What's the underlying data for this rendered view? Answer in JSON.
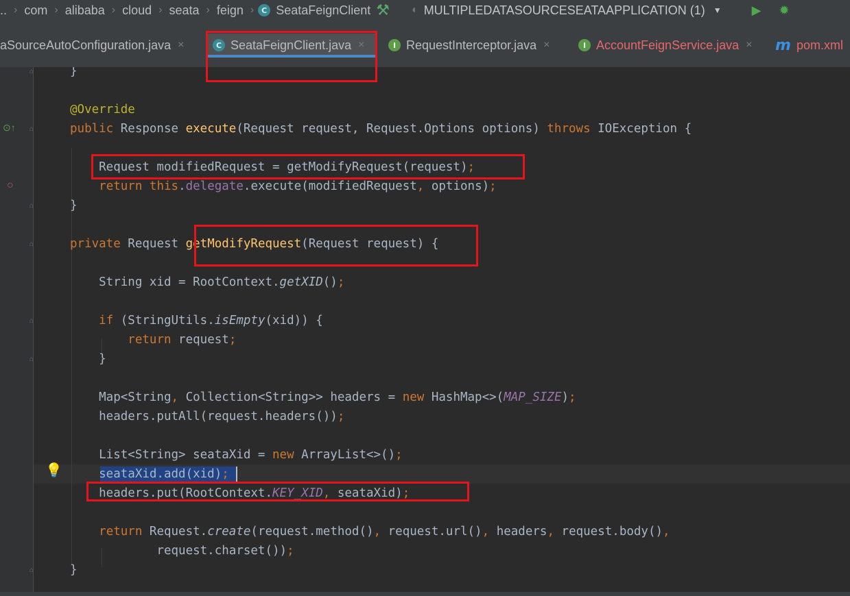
{
  "breadcrumb": {
    "items": [
      "..",
      "com",
      "alibaba",
      "cloud",
      "seata",
      "feign"
    ],
    "current_class": "SeataFeignClient",
    "run_config": "MULTIPLEDATASOURCESEATAAPPLICATION (1)"
  },
  "tabs": [
    {
      "label": "aSourceAutoConfiguration.java",
      "icon": "none",
      "active": false
    },
    {
      "label": "SeataFeignClient.java",
      "icon": "class-icon",
      "active": true
    },
    {
      "label": "RequestInterceptor.java",
      "icon": "interface-icon",
      "active": false
    },
    {
      "label": "AccountFeignService.java",
      "icon": "interface-icon",
      "active": false
    },
    {
      "label": "pom.xml",
      "icon": "maven-icon",
      "active": false
    }
  ],
  "tab_close_glyph": "×",
  "icon_glyphs": {
    "class": "C",
    "interface": "I",
    "maven": "m",
    "separator": "›",
    "hammer": "⚒",
    "dropdown": "▼",
    "run": "▶",
    "debug": "✹",
    "bulb": "💡"
  },
  "colors": {
    "keyword": "#cc7832",
    "annotation": "#bbb529",
    "method": "#ffc66d",
    "field": "#9876aa",
    "highlight_box": "#e8141c",
    "selection": "#214283"
  }
}
